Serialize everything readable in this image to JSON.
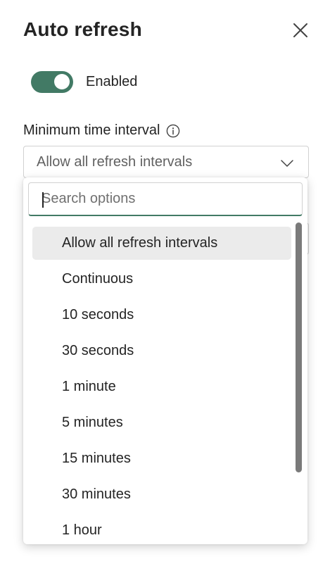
{
  "theme": {
    "accent": "#427a65"
  },
  "panel": {
    "title": "Auto refresh",
    "close_icon": "close-icon"
  },
  "toggle": {
    "label": "Enabled",
    "on": true
  },
  "interval": {
    "label": "Minimum time interval",
    "info_icon": "info-icon",
    "selected_value": "Allow all refresh intervals",
    "chevron_icon": "chevron-down-icon"
  },
  "popup": {
    "search_placeholder": "Search options",
    "options": [
      {
        "label": "Allow all refresh intervals",
        "selected": true
      },
      {
        "label": "Continuous",
        "selected": false
      },
      {
        "label": "10 seconds",
        "selected": false
      },
      {
        "label": "30 seconds",
        "selected": false
      },
      {
        "label": "1 minute",
        "selected": false
      },
      {
        "label": "5 minutes",
        "selected": false
      },
      {
        "label": "15 minutes",
        "selected": false
      },
      {
        "label": "30 minutes",
        "selected": false
      },
      {
        "label": "1 hour",
        "selected": false
      }
    ]
  }
}
